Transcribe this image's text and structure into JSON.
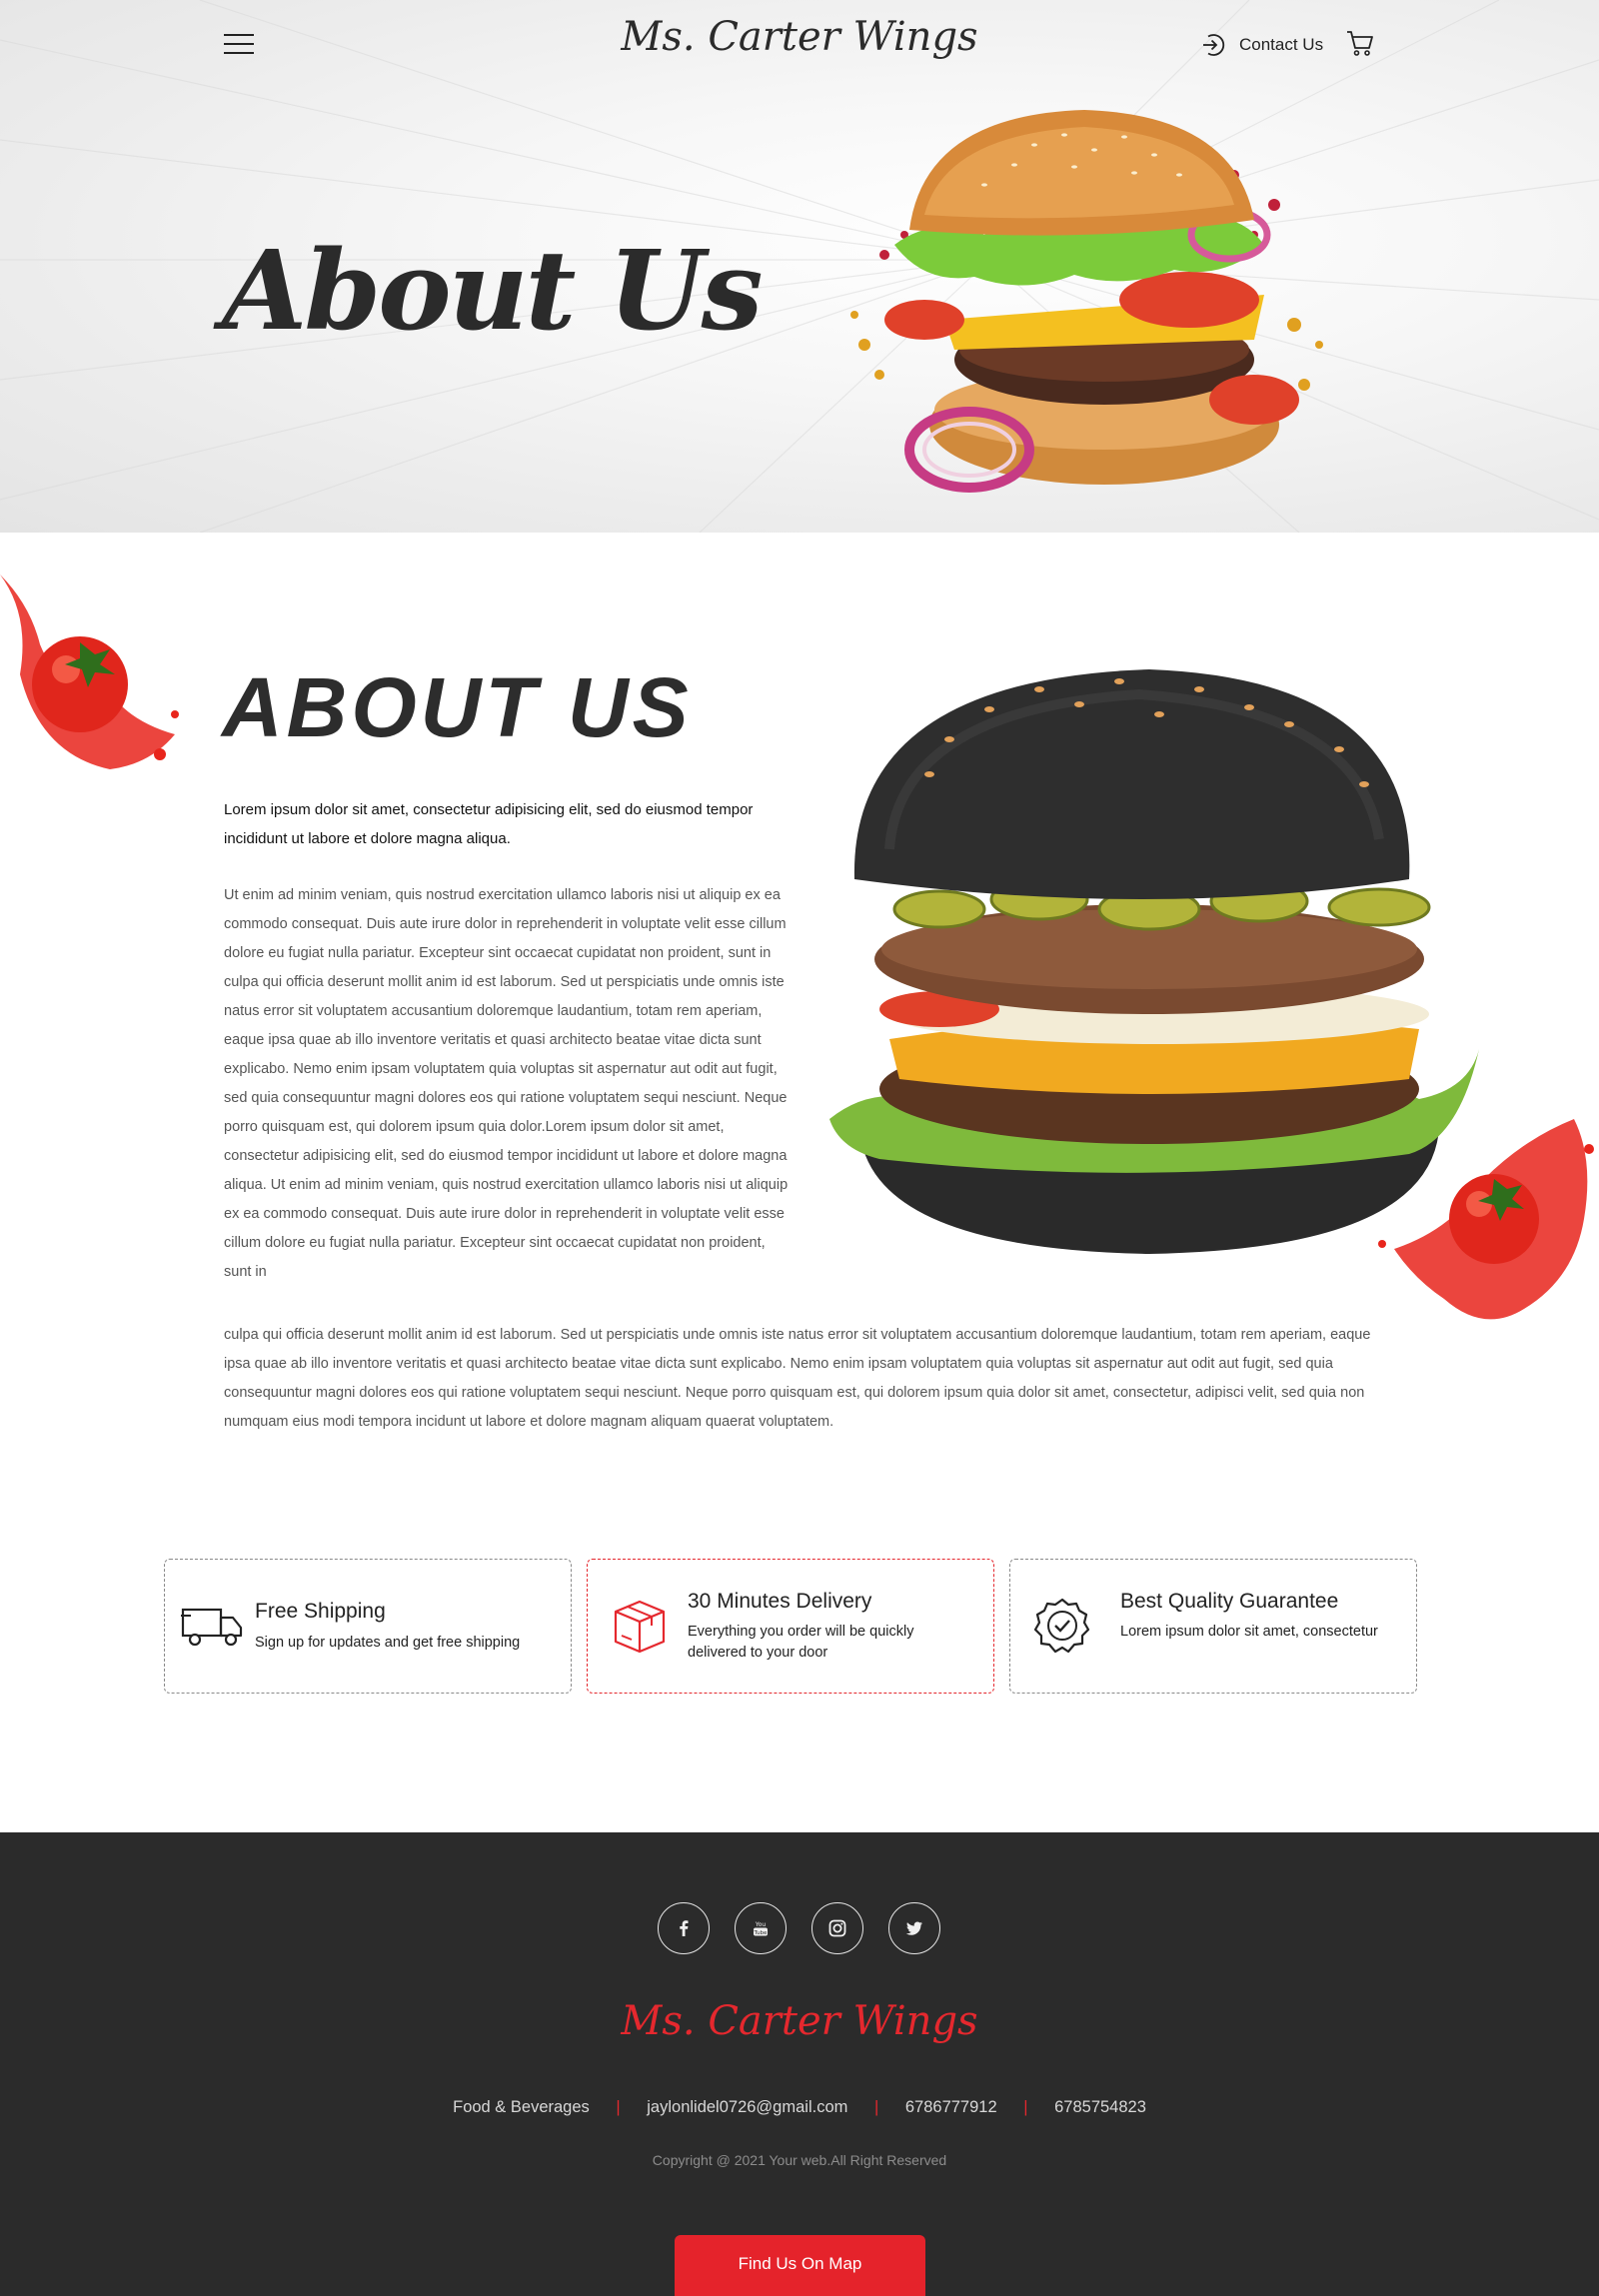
{
  "header": {
    "brand": "Ms. Carter Wings",
    "contact_label": "Contact Us",
    "icons": {
      "menu": "hamburger-menu-icon",
      "contact": "sign-in-arrow-icon",
      "cart": "shopping-cart-icon"
    }
  },
  "hero": {
    "title": "About Us"
  },
  "about": {
    "heading": "ABOUT US",
    "lead": "Lorem ipsum dolor sit amet, consectetur adipisicing elit, sed do eiusmod tempor incididunt ut labore et dolore magna aliqua.",
    "body": "Ut enim ad minim veniam, quis nostrud exercitation ullamco laboris nisi ut aliquip ex ea commodo consequat. Duis aute irure dolor in reprehenderit in voluptate velit esse cillum dolore eu fugiat nulla pariatur. Excepteur sint occaecat cupidatat non proident, sunt in culpa qui officia deserunt mollit anim id est laborum. Sed ut perspiciatis unde omnis iste natus error sit voluptatem accusantium doloremque laudantium, totam rem aperiam, eaque ipsa quae ab illo inventore veritatis et quasi architecto beatae vitae dicta sunt explicabo. Nemo enim ipsam voluptatem quia voluptas sit aspernatur aut odit aut fugit, sed quia consequuntur magni dolores eos qui ratione voluptatem sequi nesciunt. Neque porro quisquam est, qui dolorem ipsum quia dolor.Lorem ipsum dolor sit amet, consectetur adipisicing elit, sed do eiusmod tempor incididunt ut labore et dolore magna aliqua. Ut enim ad minim veniam, quis nostrud exercitation ullamco laboris nisi ut aliquip ex ea commodo consequat. Duis aute irure dolor in reprehenderit in voluptate velit esse cillum dolore eu fugiat nulla pariatur. Excepteur sint occaecat cupidatat non proident, sunt in",
    "body_continued": "culpa qui officia deserunt mollit anim id est laborum. Sed ut perspiciatis unde omnis iste natus error sit voluptatem accusantium doloremque laudantium, totam rem aperiam, eaque ipsa quae ab illo inventore veritatis et quasi architecto beatae vitae dicta sunt explicabo. Nemo enim ipsam voluptatem quia voluptas sit aspernatur aut odit aut fugit, sed quia consequuntur magni dolores eos qui ratione voluptatem sequi nesciunt. Neque porro quisquam est, qui dolorem ipsum quia dolor sit amet, consectetur, adipisci velit, sed quia non numquam eius modi tempora incidunt ut labore et dolore magnam aliquam quaerat voluptatem."
  },
  "features": [
    {
      "title": "Free Shipping",
      "description": "Sign up for updates and get free shipping",
      "icon": "delivery-truck-icon"
    },
    {
      "title": "30 Minutes Delivery",
      "description": "Everything you order will be quickly delivered to your door",
      "icon": "package-box-icon"
    },
    {
      "title": "Best Quality Guarantee",
      "description": "Lorem ipsum dolor sit amet, consectetur",
      "icon": "quality-badge-check-icon"
    }
  ],
  "footer": {
    "social_icons": [
      "facebook-icon",
      "youtube-icon",
      "instagram-icon",
      "twitter-icon"
    ],
    "brand": "Ms. Carter Wings",
    "category": "Food & Beverages",
    "email": "jaylonlidel0726@gmail.com",
    "phone_1": "6786777912",
    "phone_2": "6785754823",
    "separator": "|",
    "copyright": "Copyright @ 2021 Your web.All Right Reserved",
    "map_button": "Find Us On Map"
  },
  "colors": {
    "accent": "#e5282e",
    "dark": "#2b2b2b",
    "footer_bg": "#2b2b2b",
    "text": "#555555"
  }
}
